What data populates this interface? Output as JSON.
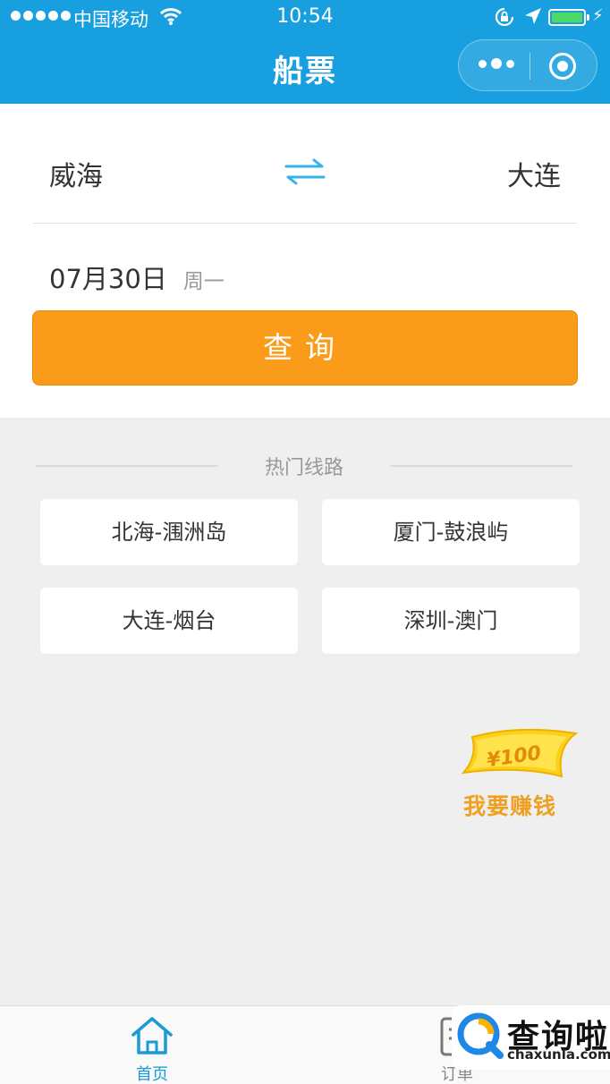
{
  "status_bar": {
    "carrier": "中国移动",
    "time": "10:54"
  },
  "nav": {
    "title": "船票"
  },
  "search": {
    "from_city": "威海",
    "to_city": "大连",
    "date": "07月30日",
    "weekday": "周一",
    "query_button": "查询"
  },
  "hot_routes": {
    "title": "热门线路",
    "routes": [
      {
        "label": "北海-涠洲岛"
      },
      {
        "label": "厦门-鼓浪屿"
      },
      {
        "label": "大连-烟台"
      },
      {
        "label": "深圳-澳门"
      }
    ]
  },
  "promo": {
    "amount": "¥100",
    "label": "我要赚钱"
  },
  "tabbar": {
    "tabs": [
      {
        "label": "首页",
        "active": true
      },
      {
        "label": "订单",
        "active": false
      }
    ]
  },
  "watermark": {
    "cn": "查询啦",
    "en": "chaxunla.com"
  },
  "colors": {
    "brand_blue": "#189fe0",
    "query_orange": "#fb9b1a",
    "background": "#efefef",
    "tab_active": "#1a9ad6"
  }
}
